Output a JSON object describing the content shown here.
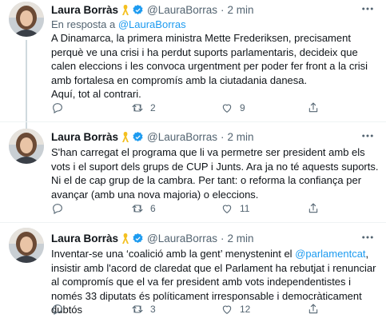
{
  "colors": {
    "accent": "#1d9bf0",
    "muted": "#536471",
    "text": "#0f1419",
    "divider": "#eff3f4"
  },
  "tweets": [
    {
      "author_name": "Laura Borràs",
      "handle": "@LauraBorras",
      "separator": "·",
      "time": "2 min",
      "reply_prefix": "En resposta a",
      "reply_handle": "@LauraBorras",
      "paragraphs": [
        "A Dinamarca, la primera ministra Mette Frederiksen, precisament perquè ve una crisi i ha perdut suports parlamentaris, decideix que calen eleccions i les convoca urgentment per poder fer front a la crisi amb fortalesa en compromís amb la ciutadania danesa.",
        "Aquí, tot al contrari."
      ],
      "reply_count": "",
      "retweet_count": "2",
      "like_count": "9",
      "icons": [
        "comment-icon",
        "retweet-icon",
        "heart-icon",
        "share-icon"
      ]
    },
    {
      "author_name": "Laura Borràs",
      "handle": "@LauraBorras",
      "separator": "·",
      "time": "2 min",
      "paragraphs": [
        "S'han carregat el programa que li va permetre ser president amb els vots i el suport dels grups de CUP i Junts. Ara ja no té aquests suports. Ni el de cap grup de la cambra. Per tant: o reforma la confiança per avançar (amb una nova majoria) o eleccions."
      ],
      "reply_count": "",
      "retweet_count": "6",
      "like_count": "11",
      "icons": [
        "comment-icon",
        "retweet-icon",
        "heart-icon",
        "share-icon"
      ]
    },
    {
      "author_name": "Laura Borràs",
      "handle": "@LauraBorras",
      "separator": "·",
      "time": "2 min",
      "text_before": "Inventar-se una ‘coalició amb la gent’ menystenint el ",
      "mention": "@parlamentcat",
      "text_after": ", insistir amb l'acord de claredat que el Parlament ha rebutjat i renunciar al compromís que el va fer president amb vots independentistes i només 33 diputats és políticament irresponsable i democràticament dubtós",
      "reply_count": "",
      "retweet_count": "3",
      "like_count": "12",
      "icons": [
        "comment-icon",
        "retweet-icon",
        "heart-icon",
        "share-icon"
      ]
    }
  ]
}
